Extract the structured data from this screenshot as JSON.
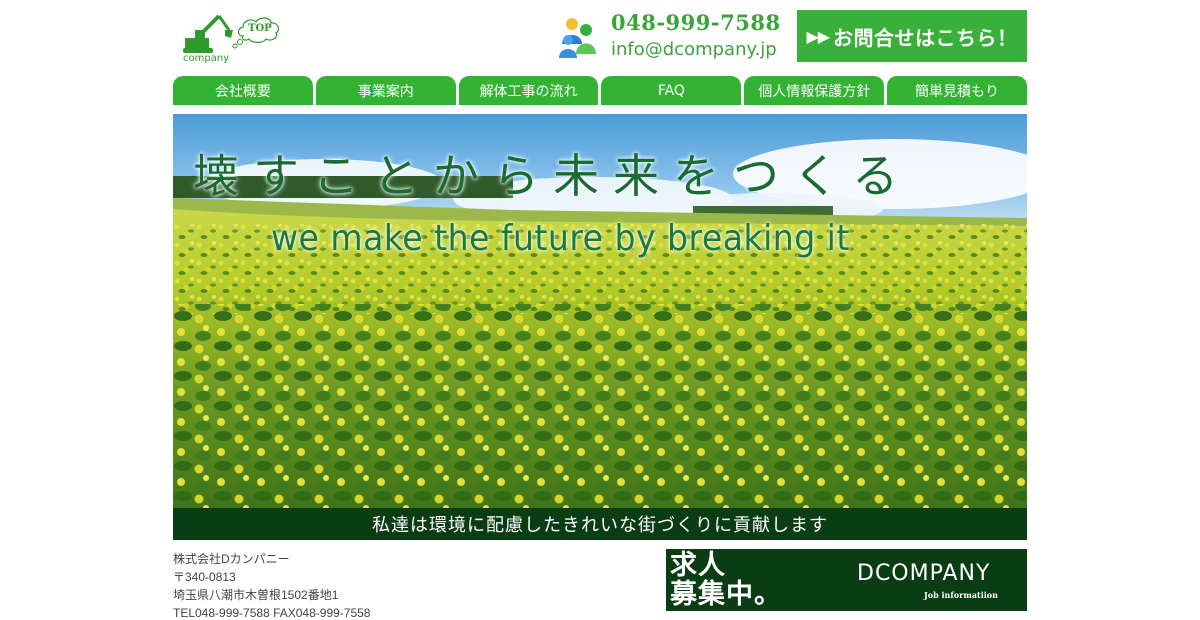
{
  "logo": {
    "bubble_text": "TOP",
    "brand_text": "company"
  },
  "contact": {
    "phone": "048-999-7588",
    "email": "info@dcompany.jp"
  },
  "cta": {
    "arrows": "▶▶",
    "label": "お問合せはこちら！"
  },
  "nav": {
    "items": [
      {
        "label": "会社概要"
      },
      {
        "label": "事業案内"
      },
      {
        "label": "解体工事の流れ"
      },
      {
        "label": "FAQ"
      },
      {
        "label": "個人情報保護方針"
      },
      {
        "label": "簡単見積もり"
      }
    ]
  },
  "hero": {
    "title_jp": "壊すことから未来をつくる",
    "title_en": "we make the future by breaking it",
    "banner": "私達は環境に配慮したきれいな街づくりに貢献します"
  },
  "footer": {
    "company": "株式会社Dカンパニー",
    "postal": "〒340-0813",
    "address": "埼玉県八潮市木曽根1502番地1",
    "tel_fax": "TEL048-999-7588 FAX048-999-7558"
  },
  "recruit": {
    "line1": "求人",
    "line2": "募集中。",
    "brand": "DCOMPANY",
    "sub": "Job informatiion"
  },
  "colors": {
    "accent": "#39b039",
    "dark": "#0b3d14"
  }
}
